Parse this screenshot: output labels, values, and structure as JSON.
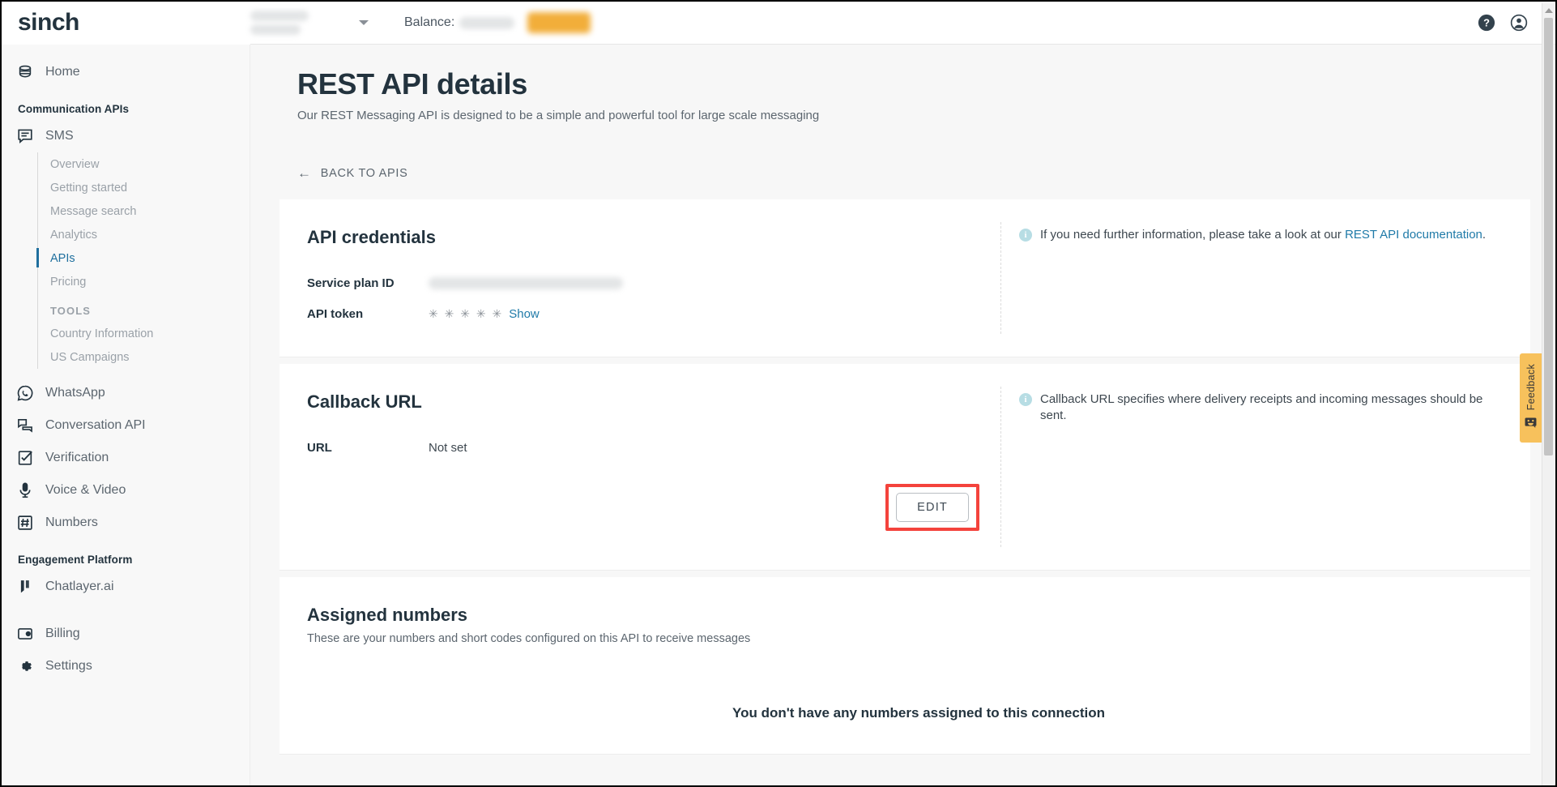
{
  "brand": {
    "logo_text": "sinch",
    "accent_color": "#1f7aa8",
    "highlight_color": "#f4433c",
    "feedback_color": "#f7c15c"
  },
  "topbar": {
    "account_redacted": true,
    "balance_label": "Balance:",
    "balance_value_redacted": true,
    "topup_button_redacted": true,
    "help_icon": "help-circle-icon",
    "account_icon": "user-circle-icon"
  },
  "sidebar": {
    "home": {
      "label": "Home",
      "icon": "home-icon"
    },
    "sections": [
      {
        "heading": "Communication APIs",
        "items": [
          {
            "label": "SMS",
            "icon": "chat-bubble-icon",
            "subitems": [
              {
                "label": "Overview",
                "active": false
              },
              {
                "label": "Getting started",
                "active": false
              },
              {
                "label": "Message search",
                "active": false
              },
              {
                "label": "Analytics",
                "active": false
              },
              {
                "label": "APIs",
                "active": true
              },
              {
                "label": "Pricing",
                "active": false
              }
            ],
            "tools_heading": "TOOLS",
            "tools": [
              {
                "label": "Country Information"
              },
              {
                "label": "US Campaigns"
              }
            ]
          },
          {
            "label": "WhatsApp",
            "icon": "whatsapp-icon"
          },
          {
            "label": "Conversation API",
            "icon": "conversation-icon"
          },
          {
            "label": "Verification",
            "icon": "check-square-icon"
          },
          {
            "label": "Voice & Video",
            "icon": "microphone-icon"
          },
          {
            "label": "Numbers",
            "icon": "hash-square-icon"
          }
        ]
      },
      {
        "heading": "Engagement Platform",
        "items": [
          {
            "label": "Chatlayer.ai",
            "icon": "chatlayer-icon"
          }
        ]
      }
    ],
    "footer_items": [
      {
        "label": "Billing",
        "icon": "wallet-icon"
      },
      {
        "label": "Settings",
        "icon": "gear-icon"
      }
    ]
  },
  "page": {
    "title": "REST API details",
    "subtitle": "Our REST Messaging API is designed to be a simple and powerful tool for large scale messaging",
    "back_link": "BACK TO APIS",
    "back_icon": "arrow-left-icon"
  },
  "credentials_card": {
    "title": "API credentials",
    "rows": [
      {
        "key": "Service plan ID",
        "value": "",
        "redacted": true
      },
      {
        "key": "API token",
        "stars": "✳ ✳ ✳ ✳ ✳",
        "action": "Show",
        "redacted": false
      }
    ],
    "info": {
      "icon": "info-icon",
      "text_before": "If you need further information, please take a look at our ",
      "link": "REST API documentation",
      "text_after": "."
    }
  },
  "callback_card": {
    "title": "Callback URL",
    "rows": [
      {
        "key": "URL",
        "value": "Not set"
      }
    ],
    "info": {
      "icon": "info-icon",
      "text": "Callback URL specifies where delivery receipts and incoming messages should be sent."
    },
    "edit_button": "EDIT",
    "edit_highlighted": true
  },
  "assigned_card": {
    "title": "Assigned numbers",
    "description": "These are your numbers and short codes configured on this API to receive messages",
    "empty_message": "You don't have any numbers assigned to this connection"
  },
  "feedback": {
    "label": "Feedback",
    "icon": "smiley-icon"
  },
  "scrollbar": {
    "up_icon": "scroll-up-arrow-icon"
  }
}
